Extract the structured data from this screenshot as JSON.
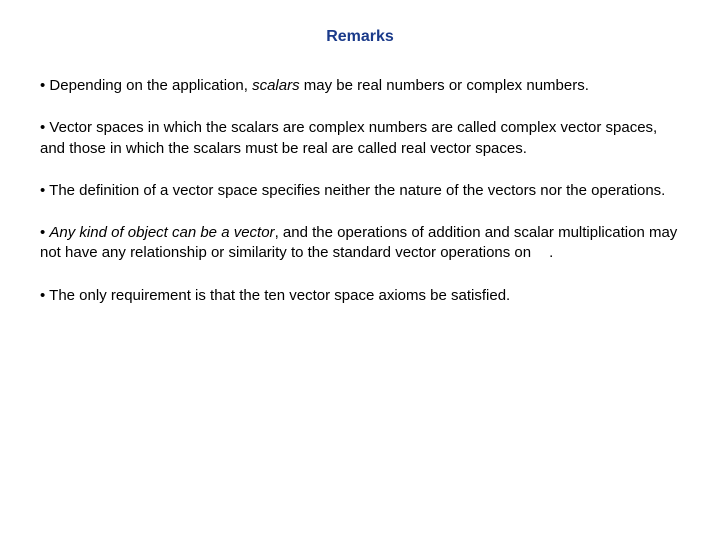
{
  "title": "Remarks",
  "bullets": {
    "b1_pre": "Depending on the application, ",
    "b1_em": "scalars",
    "b1_post": " may be real numbers or complex numbers.",
    "b2": "Vector spaces in which the scalars are complex numbers are called complex vector spaces, and those in which the scalars must be real are called real vector spaces.",
    "b3": "The definition of a vector space specifies neither the nature of the vectors nor the operations.",
    "b4_em": "Any kind of object can be a vector",
    "b4_post": ", and the operations of addition and scalar multiplication may not have any relationship or similarity to the standard vector operations on",
    "b4_suffix": ".",
    "b5": "The only requirement is that the ten vector space axioms be satisfied."
  }
}
